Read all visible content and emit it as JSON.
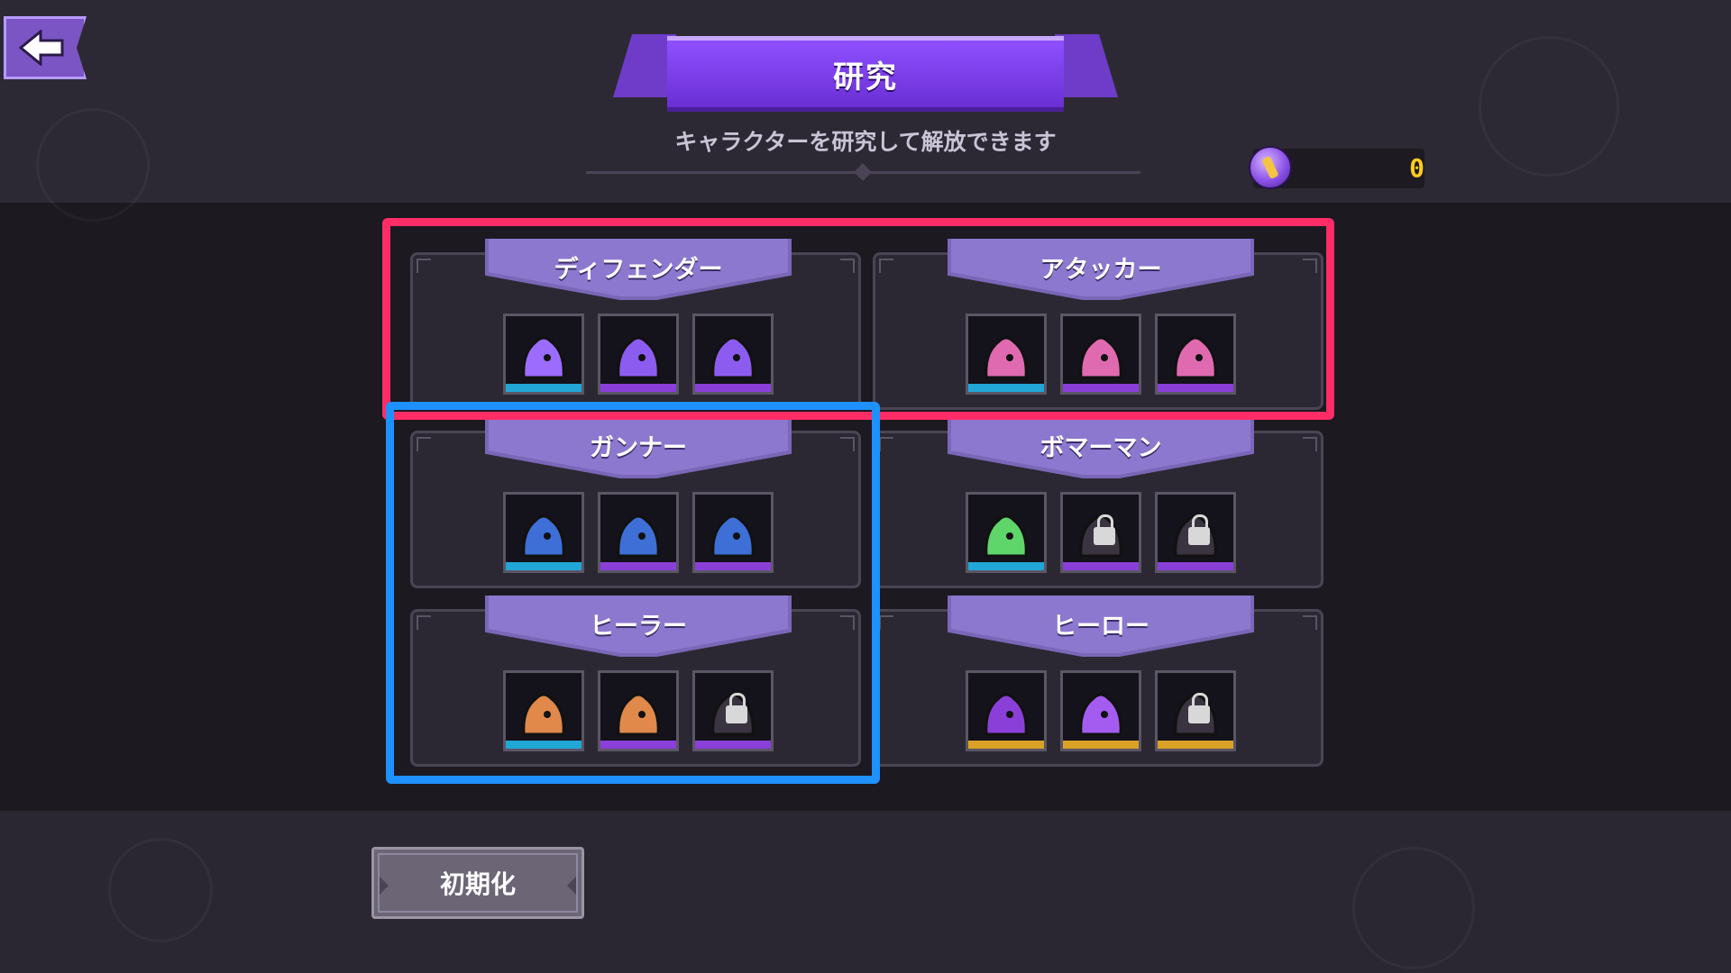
{
  "header": {
    "title": "研究",
    "subtitle": "キャラクターを研究して解放できます",
    "currency_value": "0"
  },
  "categories": [
    {
      "name": "ディフェンダー",
      "slots": [
        {
          "state": "unlocked",
          "bar": "blue"
        },
        {
          "state": "unlocked",
          "bar": "purple"
        },
        {
          "state": "unlocked",
          "bar": "purple"
        }
      ]
    },
    {
      "name": "アタッカー",
      "slots": [
        {
          "state": "unlocked",
          "bar": "blue"
        },
        {
          "state": "unlocked",
          "bar": "purple"
        },
        {
          "state": "unlocked",
          "bar": "purple"
        }
      ]
    },
    {
      "name": "ガンナー",
      "slots": [
        {
          "state": "unlocked",
          "bar": "blue"
        },
        {
          "state": "unlocked",
          "bar": "purple"
        },
        {
          "state": "unlocked",
          "bar": "purple"
        }
      ]
    },
    {
      "name": "ボマーマン",
      "slots": [
        {
          "state": "unlocked",
          "bar": "blue"
        },
        {
          "state": "locked",
          "bar": "purple"
        },
        {
          "state": "locked",
          "bar": "purple"
        }
      ]
    },
    {
      "name": "ヒーラー",
      "slots": [
        {
          "state": "unlocked",
          "bar": "blue"
        },
        {
          "state": "unlocked",
          "bar": "purple"
        },
        {
          "state": "locked",
          "bar": "purple"
        }
      ]
    },
    {
      "name": "ヒーロー",
      "slots": [
        {
          "state": "unlocked",
          "bar": "gold"
        },
        {
          "state": "unlocked",
          "bar": "gold"
        },
        {
          "state": "locked",
          "bar": "gold"
        }
      ]
    }
  ],
  "footer": {
    "reset_label": "初期化"
  },
  "colors": {
    "accent_purple": "#7b55c4",
    "highlight_red": "#ff2c66",
    "highlight_blue": "#1e90ff",
    "currency_text": "#ffcc1f"
  },
  "icons": {
    "back": "back-arrow-icon",
    "currency": "research-coin-icon",
    "lock": "lock-icon"
  }
}
